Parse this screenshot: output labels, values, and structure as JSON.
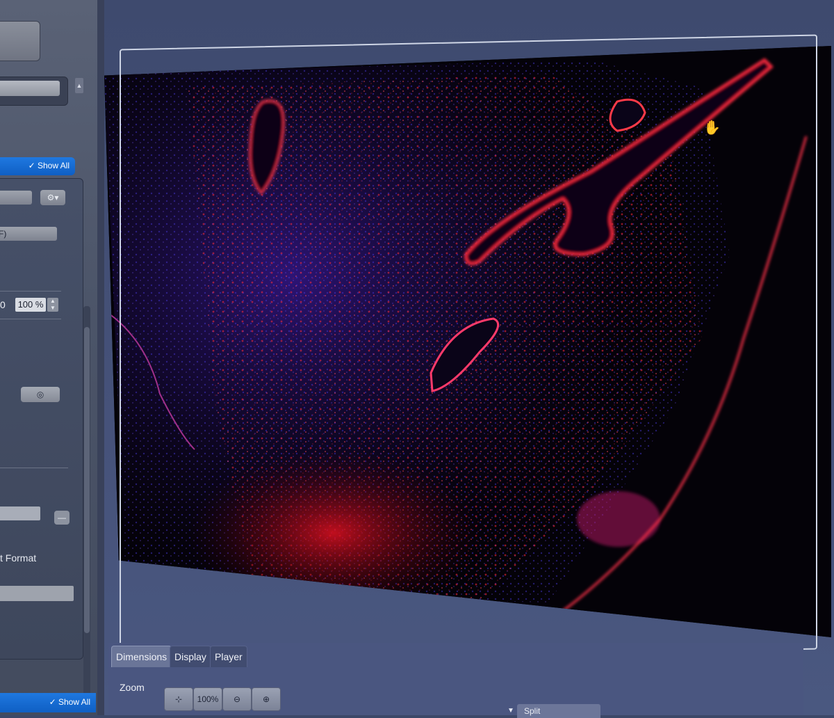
{
  "left_panel": {
    "show_all_label": "✓ Show All",
    "select_b_value": "F)",
    "zero_label": "0",
    "zoom_value": "100 %",
    "format_label": "t Format",
    "gear_icon": "⚙▾",
    "target_icon": "◎",
    "minus_icon": "—",
    "bottom_show_all_label": "✓ Show All"
  },
  "tabs": [
    {
      "label": "Dimensions",
      "active": true
    },
    {
      "label": "Display",
      "active": false
    },
    {
      "label": "Player",
      "active": false
    }
  ],
  "dimensions": {
    "zoom_label": "Zoom",
    "zoom_100_label": "100%",
    "fit_icon": "⊹",
    "zoom_out_icon": "⊖",
    "zoom_in_icon": "⊕",
    "split_label": "Split"
  },
  "colors": {
    "accent": "#1f78e0",
    "image_red": "#ff2a3a",
    "image_blue": "#3a34d8",
    "background": "#040208"
  }
}
